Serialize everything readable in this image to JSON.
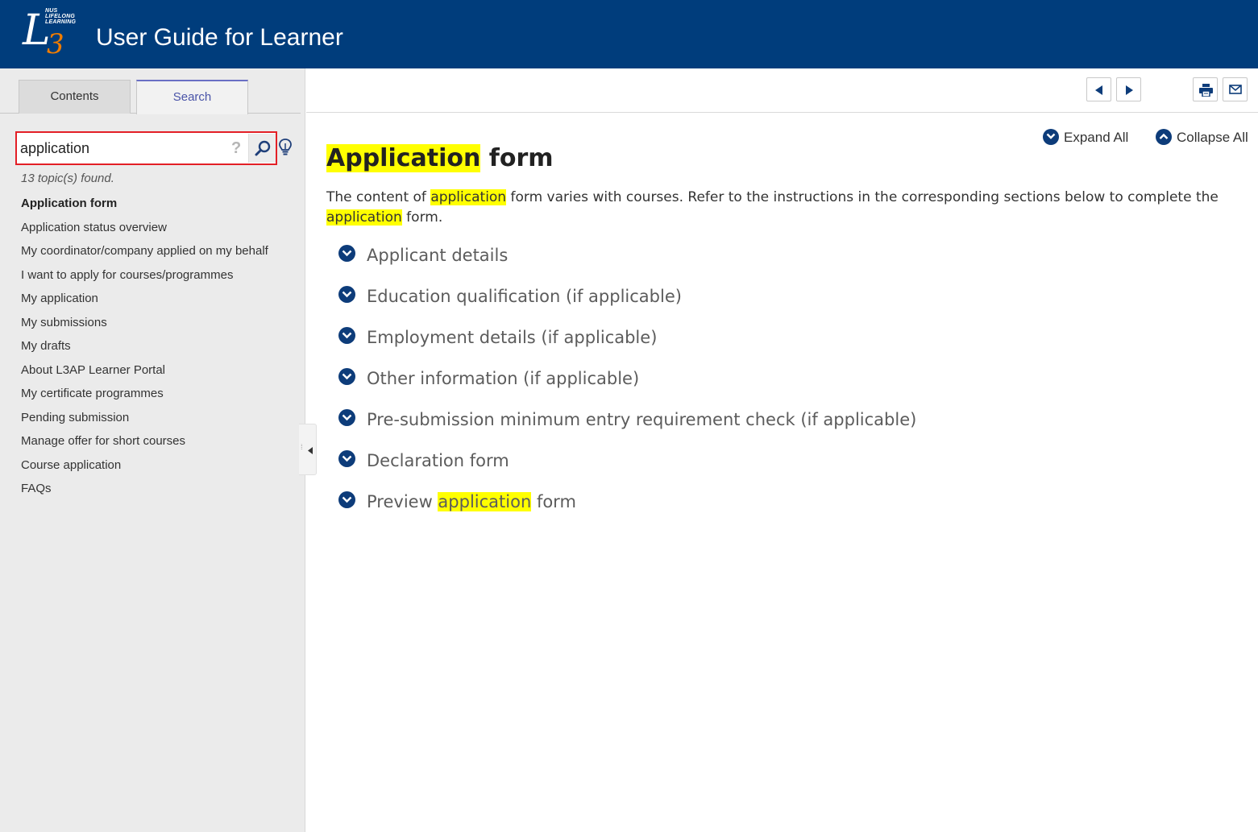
{
  "header": {
    "logo_text": "NUS LIFELONG LEARNING",
    "logo_mark": "L3",
    "title": "User Guide for Learner"
  },
  "sidebar": {
    "tabs": [
      {
        "label": "Contents"
      },
      {
        "label": "Search"
      }
    ],
    "search": {
      "value": "application",
      "help_glyph": "?"
    },
    "found_text": "13 topic(s) found.",
    "results": [
      "Application form",
      "Application status overview",
      "My coordinator/company applied on my behalf",
      "I want to apply for courses/programmes",
      "My application",
      "My submissions",
      "My drafts",
      "About L3AP Learner Portal",
      "My certificate programmes",
      "Pending submission",
      "Manage offer for short courses",
      "Course application",
      "FAQs"
    ]
  },
  "toolbar": {
    "icons": [
      "previous-icon",
      "next-icon",
      "print-icon",
      "email-icon"
    ]
  },
  "content": {
    "expand_all": "Expand All",
    "collapse_all": "Collapse All",
    "title_highlight": "Application",
    "title_rest": " form",
    "intro": {
      "part1": "The content of ",
      "hl1": "application",
      "part2": " form varies with courses. Refer to the instructions in the corresponding sections below to complete the ",
      "hl2": "application",
      "part3": " form."
    },
    "sections": [
      {
        "pre": "Applicant details",
        "hl": "",
        "post": ""
      },
      {
        "pre": "Education qualification (if applicable)",
        "hl": "",
        "post": ""
      },
      {
        "pre": "Employment details (if applicable)",
        "hl": "",
        "post": ""
      },
      {
        "pre": "Other information (if applicable)",
        "hl": "",
        "post": ""
      },
      {
        "pre": "Pre-submission minimum entry requirement check (if applicable)",
        "hl": "",
        "post": ""
      },
      {
        "pre": "Declaration form",
        "hl": "",
        "post": ""
      },
      {
        "pre": "Preview ",
        "hl": "application",
        "post": " form"
      }
    ]
  },
  "colors": {
    "header_bg": "#003d7c",
    "accent_orange": "#ef7c00",
    "highlight": "#ffff00",
    "icon_navy": "#0d3c7a",
    "search_border": "#e31f26"
  }
}
